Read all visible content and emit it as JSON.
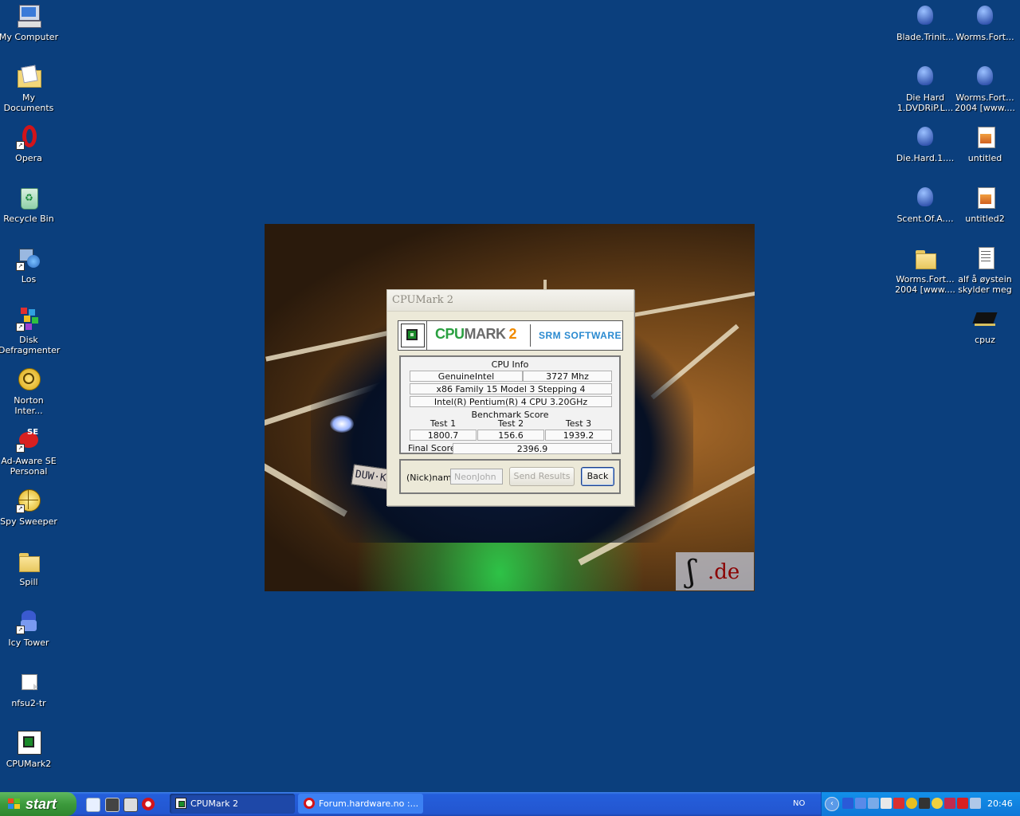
{
  "desktop": {
    "left_icons": [
      {
        "label": "My Computer"
      },
      {
        "label": "My Documents"
      },
      {
        "label": "Opera"
      },
      {
        "label": "Recycle Bin"
      },
      {
        "label": "Los"
      },
      {
        "label": "Disk Defragmenter"
      },
      {
        "label": "Norton Inter..."
      },
      {
        "label": "Ad-Aware SE Personal"
      },
      {
        "label": "Spy Sweeper"
      },
      {
        "label": "Spill"
      },
      {
        "label": "Icy Tower"
      },
      {
        "label": "nfsu2-tr"
      },
      {
        "label": "CPUMark2"
      }
    ],
    "right_icons": [
      {
        "label": "Blade.Trinit..."
      },
      {
        "label": "Worms.Fort..."
      },
      {
        "label": "Die Hard 1.DVDRiP.L..."
      },
      {
        "label": "Worms.Fort... 2004 [www...."
      },
      {
        "label": "Die.Hard.1...."
      },
      {
        "label": "untitled"
      },
      {
        "label": "Scent.Of.A...."
      },
      {
        "label": "untitled2"
      },
      {
        "label": "Worms.Fort... 2004 [www...."
      },
      {
        "label": "alf å øystein skylder meg"
      },
      {
        "label": "cpuz"
      }
    ],
    "wallpaper": {
      "plate_text": "DUW·KH",
      "watermark": ".de"
    }
  },
  "dialog": {
    "title": "CPUMark 2",
    "banner": {
      "brand_cpu": "CPU",
      "brand_mark": "MARK",
      "brand_num": "2",
      "company": "SRM SOFTWARE"
    },
    "cpu_info": {
      "heading": "CPU Info",
      "vendor": "GenuineIntel",
      "speed": "3727 Mhz",
      "family": "x86 Family 15 Model 3 Stepping 4",
      "name": "Intel(R) Pentium(R) 4 CPU 3.20GHz"
    },
    "benchmark": {
      "heading": "Benchmark Score",
      "tests": [
        {
          "label": "Test 1",
          "value": "1800.7"
        },
        {
          "label": "Test 2",
          "value": "156.6"
        },
        {
          "label": "Test 3",
          "value": "1939.2"
        }
      ],
      "final_label": "Final Score",
      "final_value": "2396.9"
    },
    "nick_label": "(Nick)name",
    "nick_placeholder": "NeonJohn",
    "send_label": "Send Results",
    "back_label": "Back"
  },
  "taskbar": {
    "start_label": "start",
    "tasks": [
      {
        "label": "CPUMark 2",
        "active": true
      },
      {
        "label": "Forum.hardware.no :...",
        "active": false
      }
    ],
    "language": "NO",
    "clock": "20:46"
  }
}
